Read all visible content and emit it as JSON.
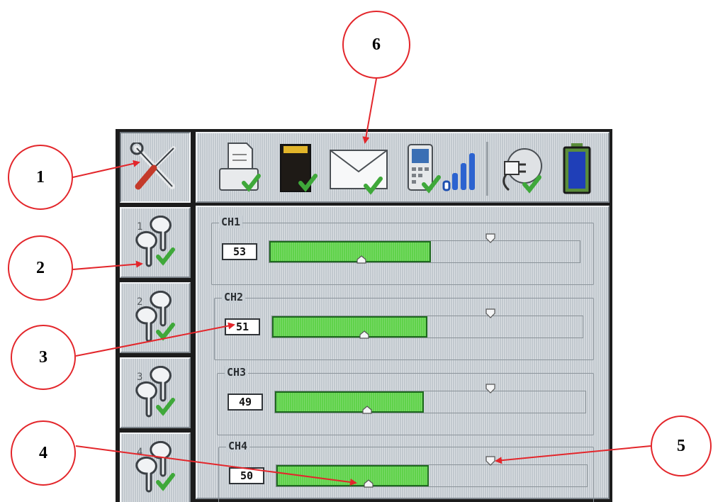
{
  "callouts": [
    "1",
    "2",
    "3",
    "4",
    "5",
    "6"
  ],
  "sidebar": {
    "items": [
      {
        "icon": "wrench-screwdriver-icon",
        "label": ""
      },
      {
        "icon": "tire-pressure-icon",
        "label": "1"
      },
      {
        "icon": "tire-pressure-icon",
        "label": "2"
      },
      {
        "icon": "tire-pressure-icon",
        "label": "3"
      },
      {
        "icon": "tire-pressure-icon",
        "label": "4"
      }
    ]
  },
  "status_icons": [
    "printer-icon",
    "sd-card-icon",
    "email-icon",
    "phone-icon",
    "signal-bars-icon",
    "power-plug-icon",
    "battery-icon"
  ],
  "channels": [
    {
      "label": "CH1",
      "value": "53",
      "level": 0.52
    },
    {
      "label": "CH2",
      "value": "51",
      "level": 0.5
    },
    {
      "label": "CH3",
      "value": "49",
      "level": 0.48
    },
    {
      "label": "CH4",
      "value": "50",
      "level": 0.49
    }
  ],
  "colors": {
    "bar_fill": "#5fd24a",
    "callout_border": "#e3262b",
    "check": "#3fa83a"
  }
}
